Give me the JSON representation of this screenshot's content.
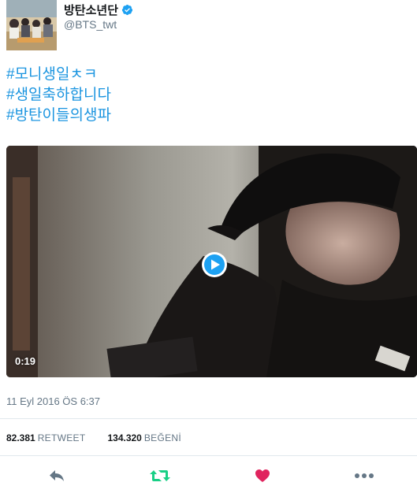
{
  "user": {
    "display_name": "방탄소년단",
    "handle": "@BTS_twt",
    "verified_icon": "verified-badge-icon"
  },
  "tweet": {
    "hashtags": [
      "#모니생일ㅊㅋ",
      "#생일축하합니다",
      "#방탄이들의생파"
    ]
  },
  "media": {
    "duration": "0:19",
    "play_icon": "play-icon"
  },
  "meta": {
    "timestamp": "11 Eyl 2016 ÖS 6:37"
  },
  "stats": {
    "retweet_count": "82.381",
    "retweet_label": "RETWEET",
    "like_count": "134.320",
    "like_label": "BEĞENİ"
  },
  "actions": {
    "reply_icon": "reply-icon",
    "retweet_icon": "retweet-icon",
    "like_icon": "heart-icon",
    "more_icon": "more-icon"
  },
  "colors": {
    "link": "#1b95e0",
    "retweet": "#19cf86",
    "like": "#e0245e",
    "muted": "#657786"
  }
}
